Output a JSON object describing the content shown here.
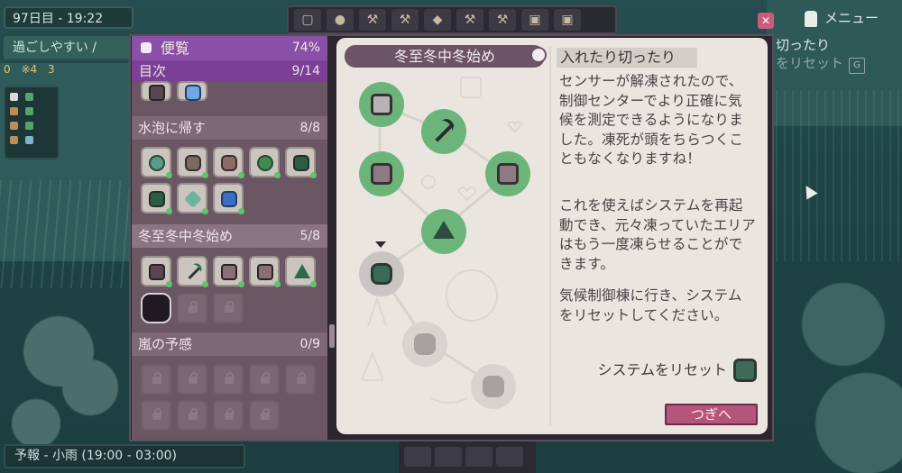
{
  "hud": {
    "day": "97日目 - 19:22",
    "comfort": "過ごしやすい /",
    "resources": [
      "0",
      "※4",
      "3"
    ],
    "menu_label": "メニュー",
    "hint_line1": "切ったり",
    "hint_line2": "をリセット",
    "hint_key": "G",
    "forecast": "予報 - 小雨 (19:00 - 03:00)"
  },
  "almanac": {
    "title": "便覧",
    "progress_pct": "74%",
    "toc_label": "目次",
    "toc_count": "9/14",
    "sections": [
      {
        "name": "水泡に帰す",
        "count": "8/8"
      },
      {
        "name": "冬至冬中冬始め",
        "count": "5/8"
      },
      {
        "name": "嵐の予感",
        "count": "0/9"
      }
    ]
  },
  "page": {
    "chapter_title": "冬至冬中冬始め",
    "entry_title": "入れたり切ったり",
    "paragraphs": [
      "センサーが解凍されたので、制御センターでより正確に気候を測定できるようになりました。凍死が頭をちらつくこともなくなりますね！",
      "これを使えばシステムを再起動でき、元々凍っていたエリアはもう一度凍らせることができます。",
      "気候制御棟に行き、システムをリセットしてください。"
    ],
    "task_label": "システムをリセット",
    "next_button": "つぎへ"
  },
  "tree_nodes": [
    {
      "id": "sensor-top",
      "state": "done",
      "icon": "box-icon"
    },
    {
      "id": "pickaxe",
      "state": "done",
      "icon": "pickaxe-icon"
    },
    {
      "id": "sensor-left",
      "state": "done",
      "icon": "sensor-icon"
    },
    {
      "id": "sensor-right",
      "state": "done",
      "icon": "sensor-icon"
    },
    {
      "id": "spire",
      "state": "done",
      "icon": "spire-icon"
    },
    {
      "id": "reset",
      "state": "active",
      "icon": "canister-icon"
    },
    {
      "id": "unknown-1",
      "state": "pending",
      "icon": "blob-icon"
    },
    {
      "id": "unknown-2",
      "state": "pending",
      "icon": "blob-icon"
    }
  ],
  "colors": {
    "accent_purple": "#8a4fa6",
    "done_green": "#6cb57a",
    "next_pink": "#b4557a"
  }
}
